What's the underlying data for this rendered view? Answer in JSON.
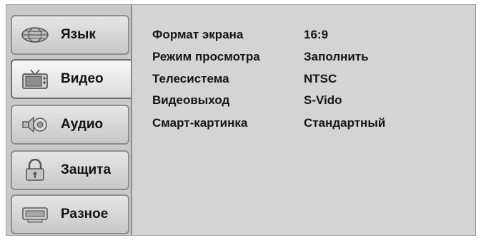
{
  "menu": {
    "tabs": [
      {
        "label": "Язык",
        "icon": "globe-icon"
      },
      {
        "label": "Видео",
        "icon": "tv-icon"
      },
      {
        "label": "Аудио",
        "icon": "speaker-icon"
      },
      {
        "label": "Защита",
        "icon": "lock-icon"
      },
      {
        "label": "Разное",
        "icon": "misc-display-icon"
      }
    ],
    "active_tab": "Видео"
  },
  "settings": [
    {
      "name": "Формат экрана",
      "value": "16:9"
    },
    {
      "name": "Режим просмотра",
      "value": "Заполнить"
    },
    {
      "name": "Телесистема",
      "value": "NTSC"
    },
    {
      "name": "Видеовыход",
      "value": "S-Vido"
    },
    {
      "name": "Смарт-картинка",
      "value": "Стандартный"
    }
  ]
}
